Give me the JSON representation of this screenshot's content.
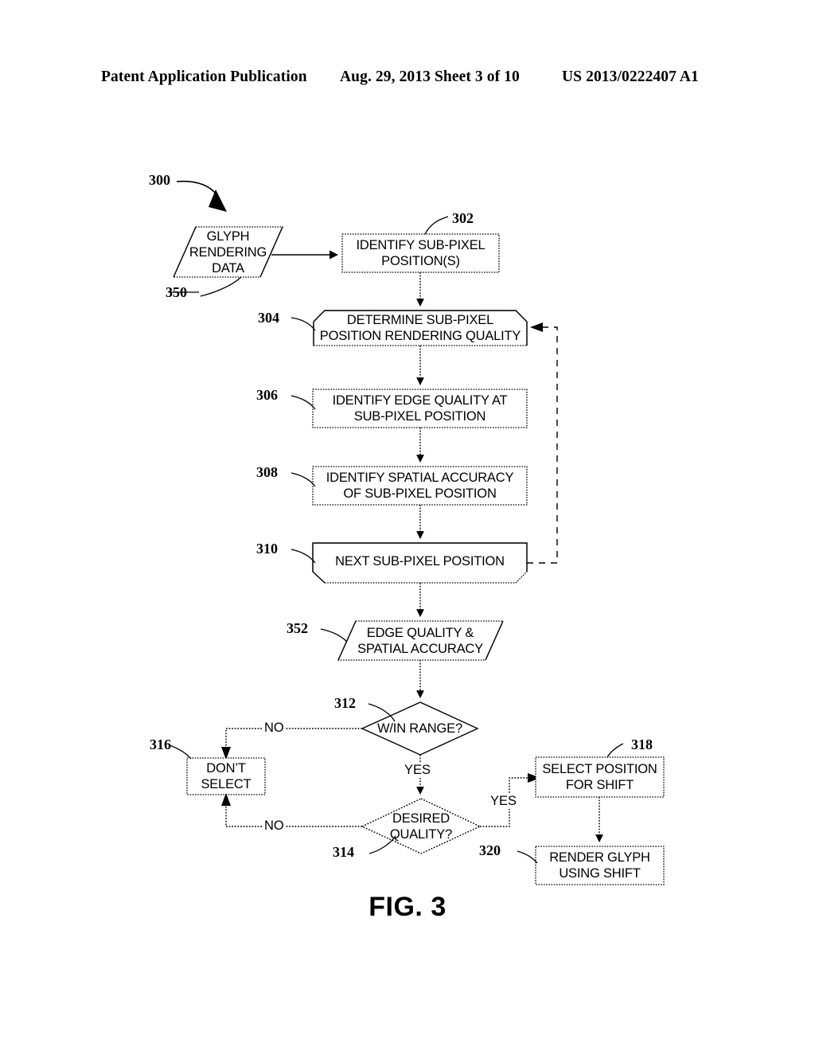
{
  "header": {
    "left": "Patent Application Publication",
    "middle": "Aug. 29, 2013  Sheet 3 of 10",
    "right": "US 2013/0222407 A1"
  },
  "figure": {
    "caption": "FIG. 3",
    "diagram_ref": "300",
    "nodes": [
      {
        "ref": "350",
        "type": "data-parallelogram",
        "label": "GLYPH\nRENDERING\nDATA"
      },
      {
        "ref": "302",
        "type": "process-box",
        "label": "IDENTIFY SUB-PIXEL\nPOSITION(S)"
      },
      {
        "ref": "304",
        "type": "process-box-beveled-top",
        "label": "DETERMINE SUB-PIXEL\nPOSITION RENDERING QUALITY"
      },
      {
        "ref": "306",
        "type": "process-box",
        "label": "IDENTIFY EDGE QUALITY  AT\nSUB-PIXEL POSITION"
      },
      {
        "ref": "308",
        "type": "process-box",
        "label": "IDENTIFY  SPATIAL ACCURACY\nOF SUB-PIXEL POSITION"
      },
      {
        "ref": "310",
        "type": "process-box-beveled-bottom",
        "label": "NEXT SUB-PIXEL POSITION"
      },
      {
        "ref": "352",
        "type": "data-parallelogram",
        "label": "EDGE QUALITY &\nSPATIAL ACCURACY"
      },
      {
        "ref": "312",
        "type": "decision-diamond",
        "label": "W/IN RANGE?"
      },
      {
        "ref": "316",
        "type": "process-box",
        "label": "DON’T\nSELECT"
      },
      {
        "ref": "314",
        "type": "decision-diamond",
        "label": "DESIRED\nQUALITY?"
      },
      {
        "ref": "318",
        "type": "process-box",
        "label": "SELECT POSITION\nFOR SHIFT"
      },
      {
        "ref": "320",
        "type": "process-box",
        "label": "RENDER GLYPH\nUSING SHIFT"
      }
    ],
    "edge_labels": [
      {
        "id": "range-no",
        "text": "NO"
      },
      {
        "id": "range-yes",
        "text": "YES"
      },
      {
        "id": "quality-no",
        "text": "NO"
      },
      {
        "id": "quality-yes",
        "text": "YES"
      }
    ]
  }
}
